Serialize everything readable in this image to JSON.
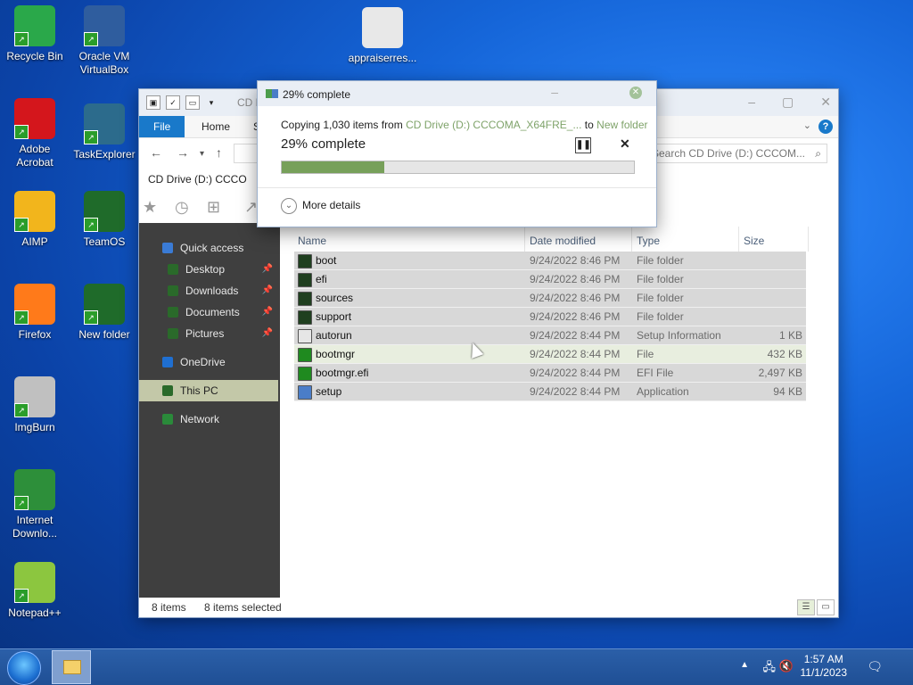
{
  "desktop": {
    "icons": [
      {
        "label": "Recycle Bin",
        "icon": "recycle-bin-icon",
        "color": "#2aa84a"
      },
      {
        "label": "Oracle VM VirtualBox",
        "icon": "virtualbox-icon",
        "color": "#2f5d9e"
      },
      {
        "label": "appraiserres...",
        "icon": "settings-file-icon",
        "color": "#e8e8e8"
      },
      {
        "label": "Adobe Acrobat",
        "icon": "acrobat-icon",
        "color": "#d4161c"
      },
      {
        "label": "TaskExplorer",
        "icon": "task-explorer-icon",
        "color": "#2c6b8c"
      },
      {
        "label": "AIMP",
        "icon": "aimp-icon",
        "color": "#f2b51c"
      },
      {
        "label": "TeamOS",
        "icon": "teamos-icon",
        "color": "#1f6b2a"
      },
      {
        "label": "Firefox",
        "icon": "firefox-icon",
        "color": "#ff7a1a"
      },
      {
        "label": "New folder",
        "icon": "folder-icon",
        "color": "#1f6b2a"
      },
      {
        "label": "ImgBurn",
        "icon": "imgburn-icon",
        "color": "#c0c0c0"
      },
      {
        "label": "Internet Downlo...",
        "icon": "idm-icon",
        "color": "#2d8f3a"
      },
      {
        "label": "Notepad++",
        "icon": "notepadpp-icon",
        "color": "#8cc63f"
      }
    ]
  },
  "explorer": {
    "title": "CD D",
    "tabs": {
      "file": "File",
      "home": "Home",
      "share": "S"
    },
    "tab_title": "CD Drive (D:) CCCO",
    "search_placeholder": "Search CD Drive (D:) CCCOM...",
    "sidebar": [
      {
        "label": "Quick access",
        "icon": "star-icon",
        "color": "#3a7bd5",
        "indent": 0,
        "pinned": false,
        "selected": false
      },
      {
        "label": "Desktop",
        "icon": "desktop-folder-icon",
        "color": "#2a6a2a",
        "indent": 1,
        "pinned": true,
        "selected": false
      },
      {
        "label": "Downloads",
        "icon": "downloads-folder-icon",
        "color": "#2a6a2a",
        "indent": 1,
        "pinned": true,
        "selected": false
      },
      {
        "label": "Documents",
        "icon": "documents-folder-icon",
        "color": "#2a6a2a",
        "indent": 1,
        "pinned": true,
        "selected": false
      },
      {
        "label": "Pictures",
        "icon": "pictures-folder-icon",
        "color": "#2a6a2a",
        "indent": 1,
        "pinned": true,
        "selected": false
      },
      {
        "label": "OneDrive",
        "icon": "onedrive-icon",
        "color": "#1f6fd1",
        "indent": 0,
        "pinned": false,
        "selected": false
      },
      {
        "label": "This PC",
        "icon": "this-pc-icon",
        "color": "#2a6a2a",
        "indent": 0,
        "pinned": false,
        "selected": true
      },
      {
        "label": "Network",
        "icon": "network-icon",
        "color": "#2a8a3a",
        "indent": 0,
        "pinned": false,
        "selected": false
      }
    ],
    "columns": {
      "name": "Name",
      "date": "Date modified",
      "type": "Type",
      "size": "Size"
    },
    "rows": [
      {
        "name": "boot",
        "date": "9/24/2022 8:46 PM",
        "type": "File folder",
        "size": "",
        "icon": "folder-icon",
        "color": "#1f3f1f"
      },
      {
        "name": "efi",
        "date": "9/24/2022 8:46 PM",
        "type": "File folder",
        "size": "",
        "icon": "folder-icon",
        "color": "#1f3f1f"
      },
      {
        "name": "sources",
        "date": "9/24/2022 8:46 PM",
        "type": "File folder",
        "size": "",
        "icon": "folder-icon",
        "color": "#1f3f1f"
      },
      {
        "name": "support",
        "date": "9/24/2022 8:46 PM",
        "type": "File folder",
        "size": "",
        "icon": "folder-icon",
        "color": "#1f3f1f"
      },
      {
        "name": "autorun",
        "date": "9/24/2022 8:44 PM",
        "type": "Setup Information",
        "size": "1 KB",
        "icon": "settings-file-icon",
        "color": "#e6e6e6"
      },
      {
        "name": "bootmgr",
        "date": "9/24/2022 8:44 PM",
        "type": "File",
        "size": "432 KB",
        "icon": "file-icon",
        "color": "#1f8a1f"
      },
      {
        "name": "bootmgr.efi",
        "date": "9/24/2022 8:44 PM",
        "type": "EFI File",
        "size": "2,497 KB",
        "icon": "file-icon",
        "color": "#1f8a1f"
      },
      {
        "name": "setup",
        "date": "9/24/2022 8:44 PM",
        "type": "Application",
        "size": "94 KB",
        "icon": "setup-icon",
        "color": "#4a7dc8"
      }
    ],
    "status": {
      "count": "8 items",
      "selected": "8 items selected"
    }
  },
  "copy_dialog": {
    "title": "29% complete",
    "line_prefix": "Copying 1,030 items from",
    "source": "CD Drive (D:) CCCOMA_X64FRE_...",
    "to": "to",
    "destination": "New folder",
    "big_status": "29% complete",
    "progress": 0.29,
    "more_details": "More details",
    "accent": "#77a05a"
  },
  "taskbar": {
    "time": "1:57 AM",
    "date": "11/1/2023"
  }
}
